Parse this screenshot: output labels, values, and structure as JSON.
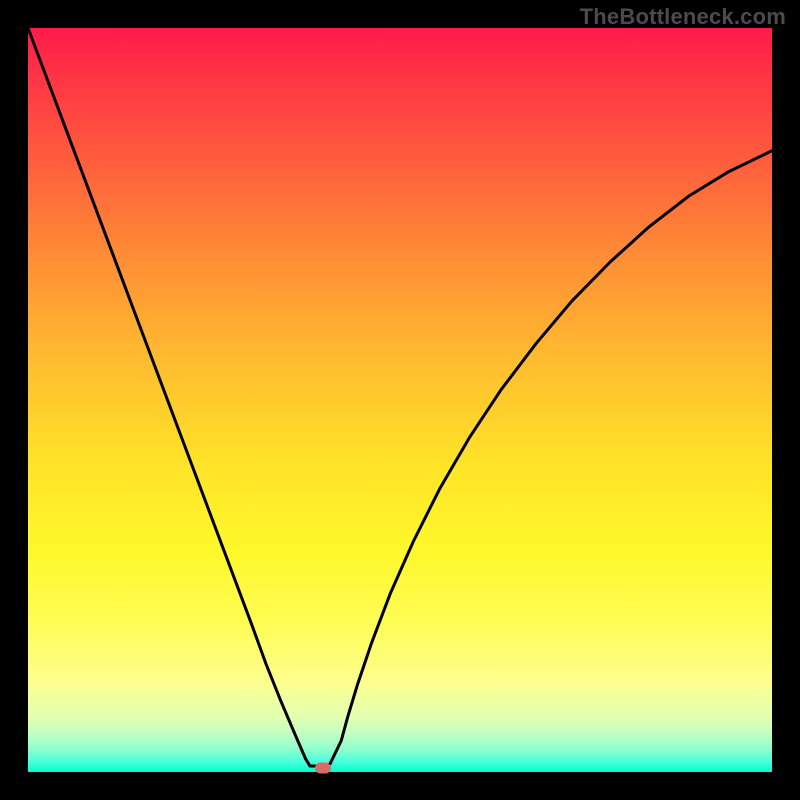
{
  "watermark": "TheBottleneck.com",
  "chart_data": {
    "type": "line",
    "title": "",
    "xlabel": "",
    "ylabel": "",
    "x_range": [
      0,
      100
    ],
    "y_range": [
      0,
      100
    ],
    "grid": false,
    "series": [
      {
        "name": "bottleneck-curve",
        "color": "#000000",
        "x": [
          0,
          3,
          6,
          9,
          12,
          15,
          18,
          21,
          24,
          27,
          30,
          32,
          34,
          36,
          37.3,
          37.9,
          38.5,
          39.3,
          40.6,
          42.1,
          43.0,
          44.3,
          46.2,
          48.7,
          51.8,
          55.3,
          59.3,
          63.6,
          68.3,
          73.1,
          78.3,
          83.5,
          88.8,
          94.2,
          100
        ],
        "y": [
          100,
          92,
          84,
          76,
          68,
          60,
          52,
          44,
          36,
          28,
          20,
          14.5,
          9.5,
          4.8,
          1.8,
          0.8,
          0.8,
          0.8,
          1.1,
          4.2,
          7.5,
          11.8,
          17.4,
          24.0,
          31.0,
          38.0,
          44.9,
          51.4,
          57.6,
          63.3,
          68.6,
          73.3,
          77.4,
          80.7,
          83.5
        ]
      }
    ],
    "marker": {
      "x": 39.6,
      "y": 0.6,
      "color": "#d86a6a"
    },
    "background_gradient": {
      "top": "#ff1a4b",
      "mid": "#ffe228",
      "bottom": "#00ffcc"
    }
  }
}
